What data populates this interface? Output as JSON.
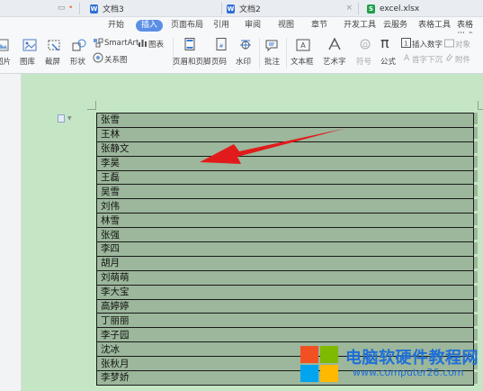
{
  "titlebar": {
    "tabs": [
      {
        "label": "文档3",
        "icon": "W",
        "color": "#2f6fd8"
      },
      {
        "label": "文档2",
        "icon": "W",
        "color": "#2f6fd8"
      },
      {
        "label": "excel.xlsx",
        "icon": "S",
        "color": "#1e9e4a"
      }
    ],
    "close_glyph": "×",
    "dot_glyph": "•"
  },
  "ribbon": {
    "tabs": [
      "开始",
      "插入",
      "页面布局",
      "引用",
      "审阅",
      "视图",
      "章节",
      "开发工具",
      "云服务",
      "表格工具",
      "表格样式"
    ],
    "active_tab": "插入"
  },
  "toolbar": {
    "picture": "图片",
    "gallery": "图库",
    "screenshot": "截屏",
    "shapes": "形状",
    "smartart": "SmartArt",
    "chart": "图表",
    "relation": "关系图",
    "header_footer": "页眉和页脚",
    "page_number": "页码",
    "watermark": "水印",
    "comment": "批注",
    "textbox": "文本框",
    "wordart": "艺术字",
    "symbol": "符号",
    "formula": "公式",
    "insert_number": "插入数字",
    "object": "对象",
    "first_letter": "首字下沉",
    "attachment": "附件"
  },
  "table": {
    "names": [
      "张雪",
      "王林",
      "张静文",
      "李昊",
      "王磊",
      "吴雪",
      "刘伟",
      "林雪",
      "张强",
      "李四",
      "胡月",
      "刘萌萌",
      "李大宝",
      "高婷婷",
      "丁丽丽",
      "李子园",
      "沈冰",
      "张秋月",
      "李梦娇"
    ]
  },
  "watermark": {
    "title": "电脑软硬件教程网",
    "url": "www.computer26.com"
  },
  "colors": {
    "page_bg": "#c5e6c5",
    "table_fill": "#9cb79b",
    "arrow": "#e11b1b",
    "accent": "#5b8fe6"
  }
}
